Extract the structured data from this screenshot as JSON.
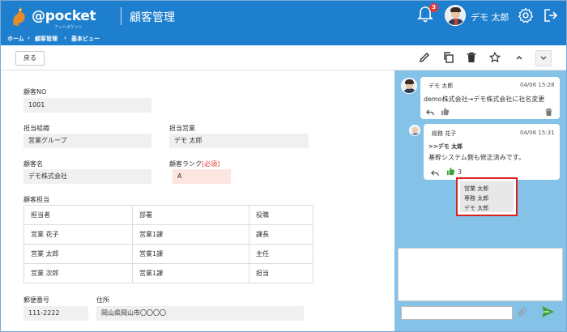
{
  "header": {
    "brand": "@pocket",
    "brand_sub": "アットポケット",
    "app_title": "顧客管理",
    "notification_count": "3",
    "user_name": "デモ 太郎"
  },
  "breadcrumb": [
    "ホーム",
    "顧客管理",
    "基本ビュー"
  ],
  "toolbar": {
    "back_label": "戻る"
  },
  "form": {
    "customer_no_label": "顧客NO",
    "customer_no": "1001",
    "org_label": "担当組織",
    "org": "営業グループ",
    "sales_label": "担当営業",
    "sales": "デモ 太郎",
    "name_label": "顧客名",
    "name": "デモ株式会社",
    "rank_label": "顧客ランク",
    "required_mark": "[必須]",
    "rank": "A",
    "contacts_label": "顧客担当",
    "postal_label": "郵便番号",
    "postal": "111-2222",
    "address_label": "住所",
    "address": "岡山県岡山市〇〇〇〇"
  },
  "contacts_table": {
    "headers": [
      "担当者",
      "部署",
      "役職"
    ],
    "rows": [
      [
        "営業 花子",
        "営業1課",
        "課長"
      ],
      [
        "営業 太郎",
        "営業1課",
        "主任"
      ],
      [
        "営業 次郎",
        "営業1課",
        "担当"
      ]
    ]
  },
  "chat": {
    "messages": [
      {
        "author": "デモ 太郎",
        "time": "04/06 15:28",
        "lines": [
          "demo株式会社→デモ株式会社に社名変更"
        ]
      },
      {
        "author": "総務 花子",
        "time": "04/06 15:31",
        "lines": [
          ">>デモ 太郎",
          "基幹システム側も修正済みです。"
        ],
        "like_count": "3"
      }
    ],
    "likers": [
      "営業 太郎",
      "専務 太郎",
      "デモ 太郎"
    ]
  },
  "colors": {
    "header_blue": "#1f7fcf",
    "chat_bg": "#84c2e8",
    "like_green": "#3aa335",
    "highlight_red": "#d9221f"
  }
}
